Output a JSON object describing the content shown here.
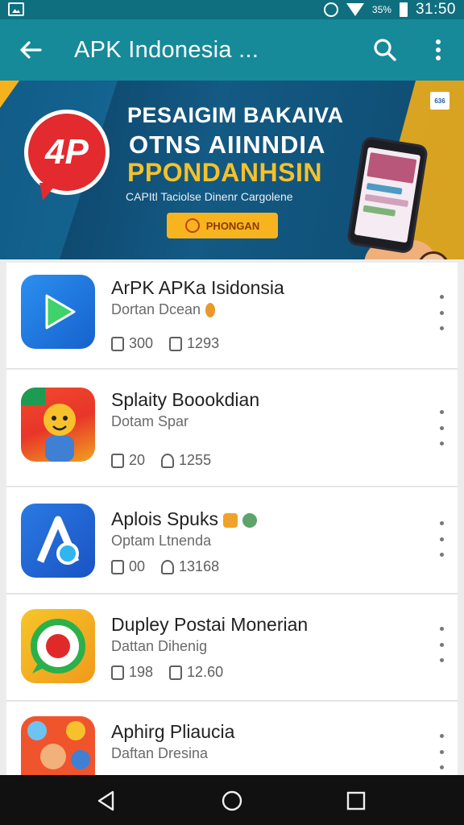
{
  "status_bar": {
    "battery_text": "35%",
    "time": "31:50"
  },
  "app_bar": {
    "title": "APK Indonesia ..."
  },
  "banner": {
    "logo_text": "4P",
    "headline_1": "PESAIGIM BAKAIVA",
    "headline_2": "OTNS  AIINNDIA",
    "headline_3": "PPONDANHSIN",
    "subtitle": "CAPItl Taciolse Dinenr Cargolene",
    "cta_label": "PHONGAN",
    "badge_text": "636",
    "colors": {
      "accent": "#f7b41f",
      "logo_red": "#e32a2f"
    }
  },
  "apps": [
    {
      "name": "ArPK APKa Isidonsia",
      "developer": "Dortan Dcean",
      "stat1": "300",
      "stat2": "1293",
      "icon": "play-triangle-icon"
    },
    {
      "name": "Splaity Boookdian",
      "developer": "Dotam Spar",
      "stat1": "20",
      "stat2": "1255",
      "icon": "cartoon-character-icon"
    },
    {
      "name": "Aplois Spuks",
      "developer": "Optam Ltnenda",
      "stat1": "00",
      "stat2": "13168",
      "icon": "letter-a-icon"
    },
    {
      "name": "Dupley Postai Monerian",
      "developer": "Dattan Dihenig",
      "stat1": "198",
      "stat2": "12.60",
      "icon": "record-dot-icon"
    },
    {
      "name": "Aphirg Pliaucia",
      "developer": "Daftan Dresina",
      "stat1": "",
      "stat2": "",
      "icon": "emoji-faces-icon"
    }
  ]
}
